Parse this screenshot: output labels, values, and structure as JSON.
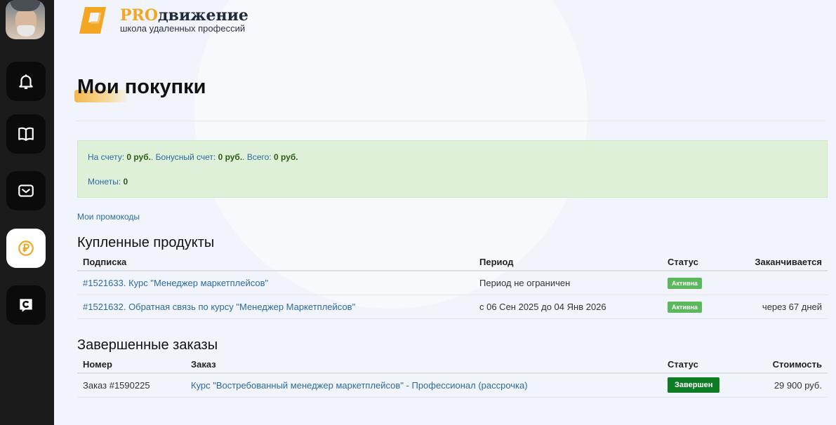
{
  "brand": {
    "pro": "PRO",
    "name_rest": "движение",
    "subtitle": "школа удаленных профессий",
    "accent": "#f3a621"
  },
  "sidebar": {
    "items": [
      {
        "icon": "bell-icon",
        "active": false
      },
      {
        "icon": "book-icon",
        "active": false
      },
      {
        "icon": "mail-icon",
        "active": false
      },
      {
        "icon": "ruble-coin-icon",
        "active": true
      },
      {
        "icon": "chat-c-icon",
        "active": false
      }
    ]
  },
  "page": {
    "title": "Мои покупки"
  },
  "balance": {
    "account_label": "На счету:",
    "account_value": "0 руб.",
    "bonus_label": ". Бонусный счет:",
    "bonus_value": "0 руб.",
    "total_label": ". Всего:",
    "total_value": "0 руб.",
    "coins_label": "Монеты:",
    "coins_value": "0"
  },
  "promo_link": "Мои промокоды",
  "purchased": {
    "title": "Купленные продукты",
    "headers": [
      "Подписка",
      "Период",
      "Статус",
      "Заканчивается"
    ],
    "rows": [
      {
        "name": "#1521633. Курс \"Менеджер маркетплейсов\"",
        "period": "Период не ограничен",
        "status": "Активна",
        "ends": ""
      },
      {
        "name": "#1521632. Обратная связь по курсу \"Менеджер Маркетплейсов\"",
        "period": "с 06 Сен 2025 до 04 Янв 2026",
        "status": "Активна",
        "ends": "через 67 дней"
      }
    ]
  },
  "completed": {
    "title": "Завершенные заказы",
    "headers": [
      "Номер",
      "Заказ",
      "Статус",
      "Стоимость"
    ],
    "rows": [
      {
        "number": "Заказ #1590225",
        "order": "Курс \"Востребованный менеджер маркетплейсов\" - Профессионал (рассрочка)",
        "status": "Завершен",
        "cost": "29 900 руб."
      }
    ]
  },
  "colors": {
    "link": "#2c6aa0",
    "active_badge": "#5cb85c",
    "done_badge": "#0e7c25",
    "balance_bg": "#dff0d8"
  }
}
